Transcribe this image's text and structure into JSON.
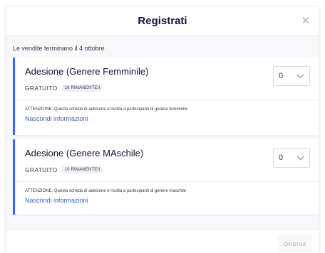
{
  "modal": {
    "title": "Registrati",
    "close_glyph": "✕"
  },
  "notice": "Le vendite terminano il 4 ottobre",
  "tickets": [
    {
      "name": "Adesione (Genere Femminile)",
      "price": "GRATUITO",
      "remaining": "16 RIMANENTE/I",
      "quantity": "0",
      "warning": "ATTENZIONE: Questa scheda di adesione è rivolta a partecipanti di genere femminile",
      "toggle_label": "Nascondi informazioni"
    },
    {
      "name": "Adesione (Genere MAschile)",
      "price": "GRATUITO",
      "remaining": "10 RIMANENTE/I",
      "quantity": "0",
      "warning": "ATTENZIONE: Questa scheda di adesione è rivolta a partecipanti di genere maschile",
      "toggle_label": "Nascondi informazioni"
    }
  ],
  "footer": {
    "order_label": "ORDINA"
  },
  "colors": {
    "accent": "#3d64ff",
    "text": "#39364f",
    "title": "#1e0a3c",
    "background": "#f8f7fa"
  },
  "icons": {
    "close": "close-icon",
    "quantity_dropdown": "chevron-down-icon"
  }
}
